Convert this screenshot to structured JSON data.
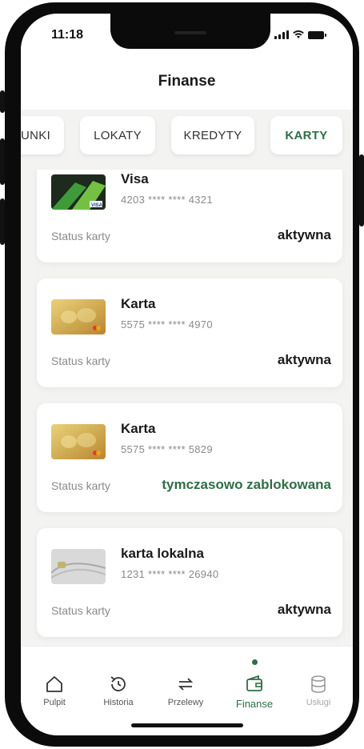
{
  "status_bar": {
    "time": "11:18"
  },
  "header": {
    "title": "Finanse"
  },
  "tabs": [
    {
      "label": "HUNKI",
      "active": false
    },
    {
      "label": "LOKATY",
      "active": false
    },
    {
      "label": "KREDYTY",
      "active": false
    },
    {
      "label": "KARTY",
      "active": true
    }
  ],
  "cards": [
    {
      "name": "Visa",
      "number": "4203 **** **** 4321",
      "status_label": "Status karty",
      "status": "aktywna",
      "image": "green-visa-card-icon"
    },
    {
      "name": "Karta",
      "number": "5575 **** **** 4970",
      "status_label": "Status karty",
      "status": "aktywna",
      "image": "gold-card-icon"
    },
    {
      "name": "Karta",
      "number": "5575 **** **** 5829",
      "status_label": "Status karty",
      "status": "tymczasowo zablokowana",
      "image": "gold-card-icon"
    },
    {
      "name": "karta lokalna",
      "number": "1231 **** **** 26940",
      "status_label": "Status karty",
      "status": "aktywna",
      "image": "grey-card-icon"
    }
  ],
  "bottom_nav": [
    {
      "label": "Pulpit",
      "icon": "home-icon"
    },
    {
      "label": "Historia",
      "icon": "history-icon"
    },
    {
      "label": "Przelewy",
      "icon": "transfer-icon"
    },
    {
      "label": "Finanse",
      "icon": "wallet-icon",
      "active": true
    },
    {
      "label": "Usługi",
      "icon": "database-icon",
      "disabled": true
    }
  ],
  "colors": {
    "accent": "#2f6e46",
    "background": "#f3f4f2",
    "card": "#ffffff"
  }
}
